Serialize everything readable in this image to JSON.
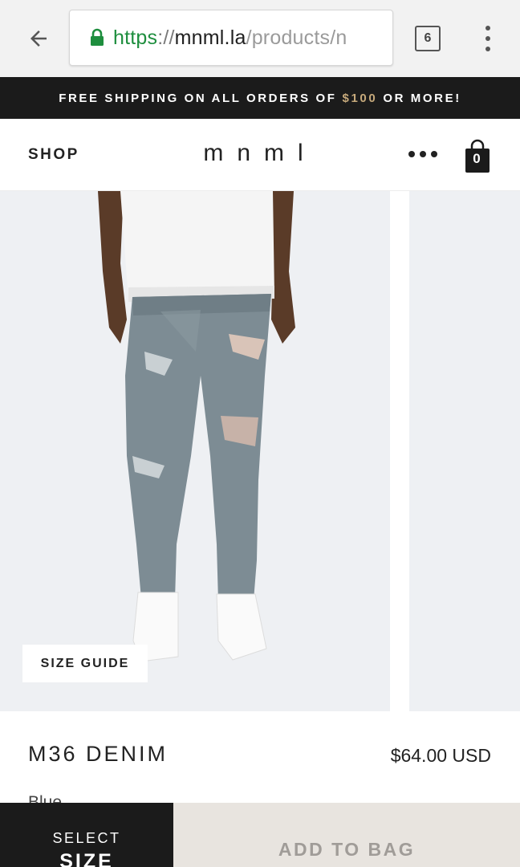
{
  "browser": {
    "back_icon": "arrow-left-icon",
    "lock_icon": "lock-icon",
    "url": {
      "scheme": "https",
      "separator": "://",
      "host": "mnml.la",
      "path": "/products/n"
    },
    "tab_count": "6",
    "menu_icon": "more-vert-icon",
    "colors": {
      "secure": "#1e8e3e",
      "bar_bg": "#f2f2f2"
    }
  },
  "promo": {
    "prefix": "FREE SHIPPING ON ALL ORDERS OF",
    "amount": "$100",
    "suffix": "OR MORE!",
    "colors": {
      "bg": "#1b1b1b",
      "accent": "#c6a97b"
    }
  },
  "header": {
    "shop_label": "SHOP",
    "logo_text": "mnml",
    "more_icon": "more-horiz-icon",
    "bag_icon": "shopping-bag-icon",
    "bag_count": "0"
  },
  "carousel": {
    "size_guide_label": "SIZE GUIDE",
    "slide_bg": "#eef0f3"
  },
  "product": {
    "name": "M36 DENIM",
    "price": "$64.00 USD",
    "color": "Blue"
  },
  "actions": {
    "select_size_line1": "SELECT",
    "select_size_line2": "SIZE",
    "add_to_bag_label": "ADD TO BAG",
    "colors": {
      "select_bg": "#1b1b1b",
      "add_bg": "#e8e4df"
    }
  }
}
